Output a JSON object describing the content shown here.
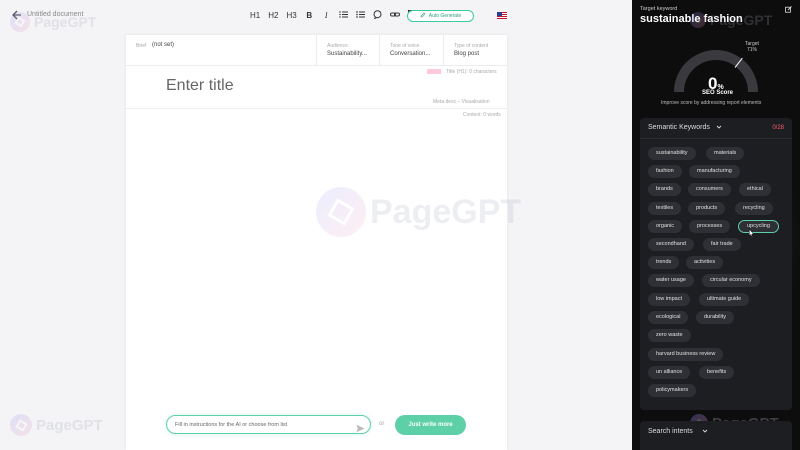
{
  "header": {
    "doc_title": "Untitled document",
    "toolbar": [
      "H1",
      "H2",
      "H3",
      "B",
      "I"
    ],
    "autogen_label": "Auto Generate"
  },
  "watermark": {
    "text": "PageGPT"
  },
  "editor": {
    "brief_label": "Brief",
    "brief_value": "(not set)",
    "audience_label": "Audience",
    "audience_value": "Sustainability...",
    "tone_label": "Tone of voice",
    "tone_value": "Conversation...",
    "type_label": "Type of content",
    "type_value": "Blog post",
    "title_hint": "Title (H1): 0 characters",
    "title_placeholder": "Enter title",
    "meta_desc": "Meta desc – Visualisation",
    "content_words": "Content: 0 words",
    "prompt_placeholder": "Fill in instructions for the AI or choose from list",
    "or_text": "or",
    "write_button": "Just write more"
  },
  "panel": {
    "target_keyword_label": "Target keyword",
    "target_keyword": "sustainable fashion",
    "target_label": "Target",
    "target_value": "71%",
    "score_value": "0",
    "score_unit": "%",
    "score_label": "SEO Score",
    "improve_text": "Improve score by addressing report elements",
    "semantic_title": "Semantic Keywords",
    "semantic_count": "0/28",
    "keywords": [
      "sustainability",
      "materials",
      "fashion",
      "manufacturing",
      "brands",
      "consumers",
      "ethical",
      "textiles",
      "products",
      "recycling",
      "organic",
      "processes",
      "upcycling",
      "secondhand",
      "fair trade",
      "trends",
      "activities",
      "water usage",
      "circular economy",
      "low impact",
      "ultimate guide",
      "ecological",
      "durability",
      "zero waste",
      "harvard business review",
      "un alliance",
      "benefits",
      "policymakers"
    ],
    "active_keyword": "upcycling",
    "search_intents_title": "Search intents"
  },
  "score_percent": 0,
  "target_percent": 71,
  "colors": {
    "accent": "#5ed0a8",
    "panel_bg": "#0d0d0e",
    "count_red": "#ff5a6e"
  }
}
